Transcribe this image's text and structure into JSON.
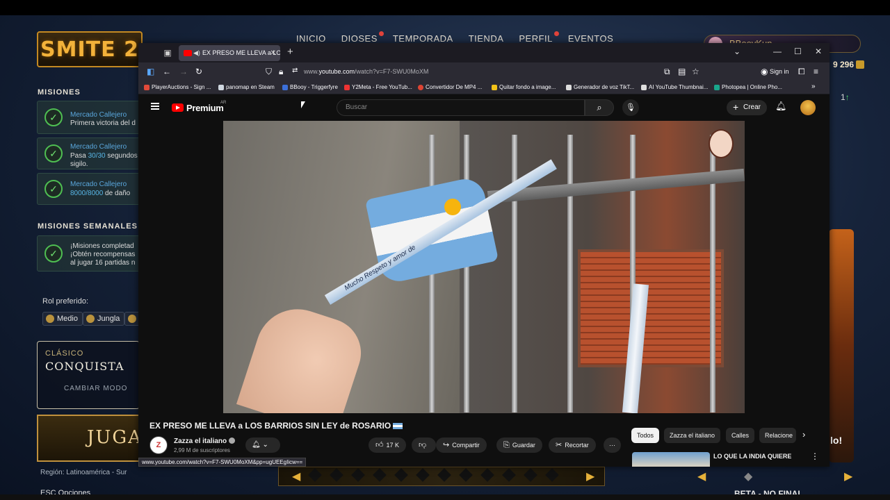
{
  "game": {
    "logo": "SMITE 2",
    "nav": [
      "INICIO",
      "DIOSES",
      "TEMPORADA",
      "TIENDA",
      "PERFIL",
      "EVENTOS"
    ],
    "player_name": "BBooyKun",
    "currency": "9 296",
    "side_count": "1",
    "missions_title": "MISIONES",
    "missions": [
      {
        "title": "Mercado Callejero",
        "desc": "Primera victoria del d"
      },
      {
        "title": "Mercado Callejero",
        "desc_prefix": "Pasa ",
        "desc_highlight": "30/30",
        "desc_suffix": " segundos",
        "desc_line2": "sigilo."
      },
      {
        "title": "Mercado Callejero",
        "desc_highlight": "8000/8000",
        "desc_suffix": " de daño"
      }
    ],
    "weekly_title": "MISIONES SEMANALES",
    "weekly": {
      "line1": "¡Misiones completad",
      "line2": "¡Obtén recompensas",
      "line3": "al jugar 16 partidas n"
    },
    "role_label": "Rol preferido:",
    "roles": [
      "Medio",
      "Jungla"
    ],
    "mode_category": "CLÁSICO",
    "mode_name": "CONQUISTA",
    "change_mode": "CAMBIAR MODO",
    "play": "JUGA",
    "region": "Región: Latinoamérica - Sur",
    "esc": "ESC  Opciones",
    "right_card_text": "lo!",
    "beta": "BETA - NO FINAL"
  },
  "browser": {
    "tab_title": "EX PRESO ME LLEVA a LOS",
    "url_prefix": "www.",
    "url_domain": "youtube.com",
    "url_path": "/watch?v=F7-SWU0MoXM",
    "sign_in": "Sign in",
    "bookmarks": [
      {
        "label": "PlayerAuctions - Sign ...",
        "color": "#e24a3a"
      },
      {
        "label": "panomap en Steam",
        "color": "#cfd7e0"
      },
      {
        "label": "BBooy - Triggerfyre",
        "color": "#3b6fd8"
      },
      {
        "label": "Y2Meta - Free YouTub...",
        "color": "#e33"
      },
      {
        "label": "Convertidor De MP4 ...",
        "color": "#d43"
      },
      {
        "label": "Quitar fondo a image...",
        "color": "#f2c218"
      },
      {
        "label": "Generador de voz TikT...",
        "color": "#ddd"
      },
      {
        "label": "AI YouTube Thumbnai...",
        "color": "#ddd"
      },
      {
        "label": "Photopea | Online Pho...",
        "color": "#19a68c"
      }
    ],
    "status_url": "www.youtube.com/watch?v=F7-SWU0MoXM&pp=ugUEEgIicw=="
  },
  "youtube": {
    "brand": "Premium",
    "region": "AR",
    "search_placeholder": "Buscar",
    "create": "Crear",
    "video_title": "EX PRESO ME LLEVA a LOS BARRIOS SIN LEY de ROSARIO",
    "ribbon_text": "Mucho Respeto y amor de",
    "channel_name": "Zazza el italiano",
    "channel_subs": "2,99 M de suscriptores",
    "likes": "17 K",
    "share": "Compartir",
    "save": "Guardar",
    "clip": "Recortar",
    "chips": [
      "Todos",
      "Zazza el italiano",
      "Calles",
      "Relacione"
    ],
    "rec_title": "LO QUE LA INDIA QUIERE"
  }
}
